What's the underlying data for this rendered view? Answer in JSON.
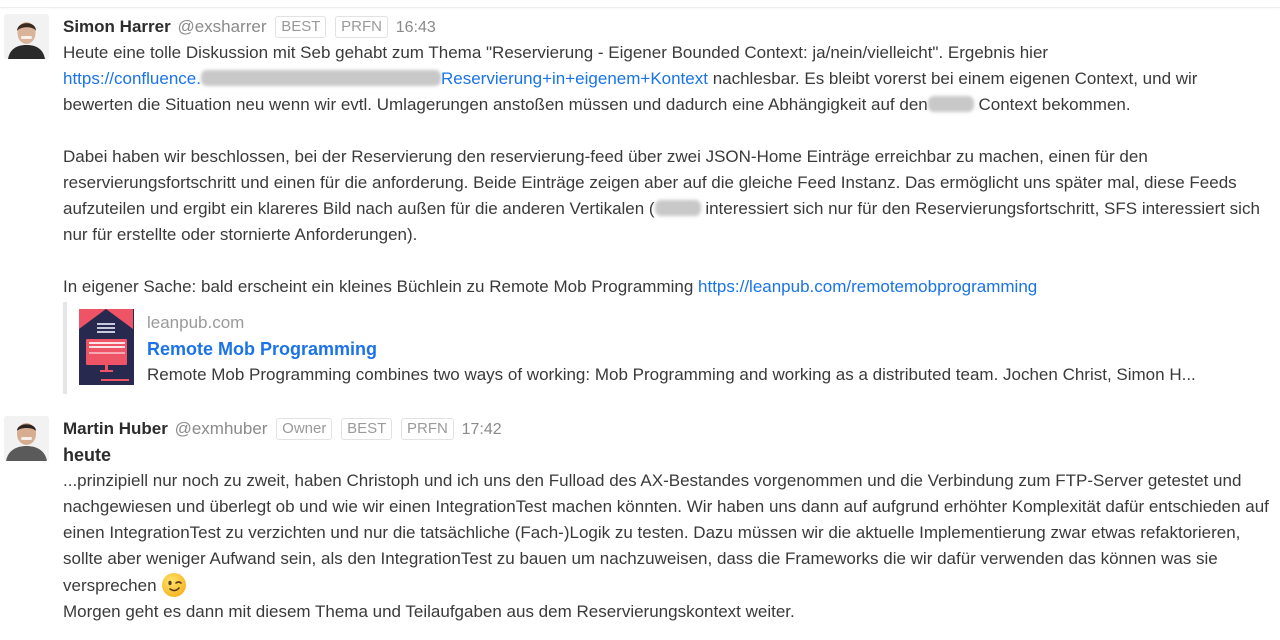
{
  "messages": [
    {
      "author": "Simon Harrer",
      "handle": "@exsharrer",
      "badges": [
        "BEST",
        "PRFN"
      ],
      "time": "16:43",
      "avatar_icon": "person-avatar",
      "body": {
        "p1_intro": "Heute eine tolle Diskussion mit Seb gehabt zum Thema \"Reservierung - Eigener Bounded Context: ja/nein/vielleicht\". Ergebnis hier",
        "p1_link_start": "https://confluence.",
        "p1_link_end": "Reservierung+in+eigenem+Kontext",
        "p1_after_link": " nachlesbar. Es bleibt vorerst bei einem eigenen Context, und wir bewerten die Situation neu wenn wir evtl. Umlagerungen anstoßen müssen und dadurch eine Abhängigkeit auf den",
        "p1_end": " Context bekommen.",
        "p2_part1": "Dabei haben wir beschlossen, bei der Reservierung den reservierung-feed über zwei JSON-Home Einträge erreichbar zu machen, einen für den reservierungsfortschritt und einen für die anforderung. Beide Einträge zeigen aber auf die gleiche Feed Instanz. Das ermöglicht uns später mal, diese Feeds aufzuteilen und ergibt ein klareres Bild nach außen für die anderen Vertikalen (",
        "p2_part2": " interessiert sich nur für den Reservierungsfortschritt, SFS interessiert sich nur für erstellte oder stornierte Anforderungen).",
        "p3_text": "In eigener Sache: bald erscheint ein kleines Büchlein zu Remote Mob Programming ",
        "p3_link": "https://leanpub.com/remotemobprogramming"
      },
      "preview": {
        "site": "leanpub.com",
        "title": "Remote Mob Programming",
        "description": "Remote Mob Programming combines two ways of working: Mob Programming and working as a distributed team. Jochen Christ, Simon H...",
        "cover_icon": "book-cover"
      }
    },
    {
      "author": "Martin Huber",
      "handle": "@exmhuber",
      "badges": [
        "Owner",
        "BEST",
        "PRFN"
      ],
      "time": "17:42",
      "avatar_icon": "person-avatar",
      "body": {
        "heading": "heute",
        "p1": "...prinzipiell nur noch zu zweit, haben Christoph und ich uns den Fulload des AX-Bestandes vorgenommen und die Verbindung zum FTP-Server getestet und nachgewiesen und überlegt ob und wie wir einen IntegrationTest machen könnten. Wir haben uns dann auf aufgrund erhöhter Komplexität dafür entschieden auf einen IntegrationTest zu verzichten und nur die tatsächliche (Fach-)Logik zu testen. Dazu müssen wir die aktuelle Implementierung zwar etwas refaktorieren, sollte aber weniger Aufwand sein, als den IntegrationTest zu bauen um nachzuweisen, dass die Frameworks die wir dafür verwenden das können was sie versprechen",
        "emoji": "winking-face",
        "p2": "Morgen geht es dann mit diesem Thema und Teilaufgaben aus dem Reservierungskontext weiter."
      }
    }
  ]
}
